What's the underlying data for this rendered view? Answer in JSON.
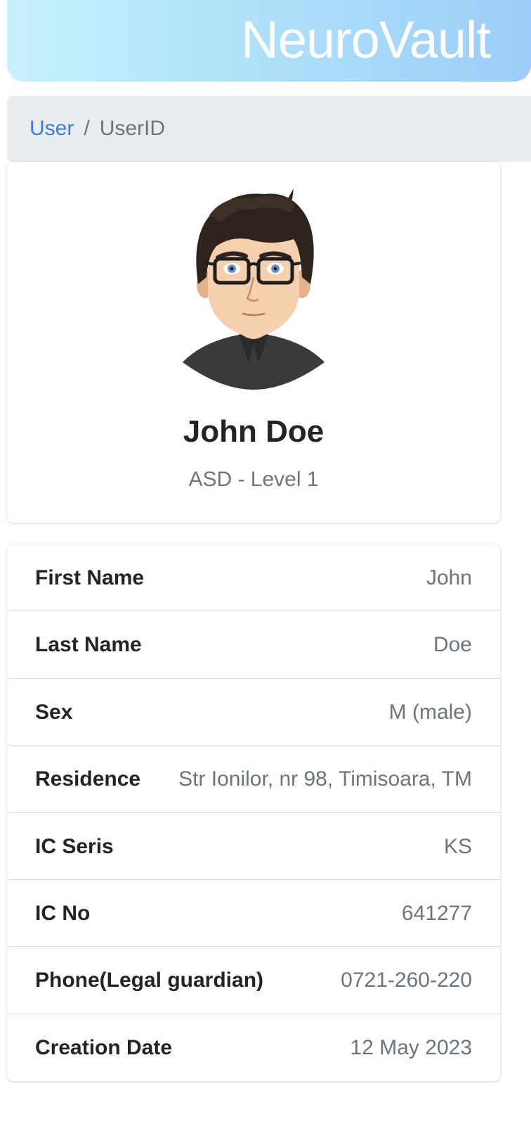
{
  "header": {
    "brand": "NeuroVault"
  },
  "breadcrumb": {
    "link": "User",
    "separator": "/",
    "current": "UserID"
  },
  "profile": {
    "name": "John Doe",
    "diagnosis": "ASD - Level 1",
    "avatar_icon": "avatar-illustration"
  },
  "details": [
    {
      "label": "First Name",
      "value": "John"
    },
    {
      "label": "Last Name",
      "value": "Doe"
    },
    {
      "label": "Sex",
      "value": "M (male)"
    },
    {
      "label": "Residence",
      "value": "Str Ionilor, nr 98, Timisoara, TM"
    },
    {
      "label": "IC Seris",
      "value": "KS"
    },
    {
      "label": "IC No",
      "value": "641277"
    },
    {
      "label": "Phone(Legal guardian)",
      "value": "0721-260-220"
    },
    {
      "label": "Creation Date",
      "value": "12 May 2023"
    }
  ],
  "colors": {
    "link": "#3b7ddd",
    "muted": "#6c757d",
    "header_gradient_start": "#c7f0fc",
    "header_gradient_end": "#9ccdf8"
  }
}
